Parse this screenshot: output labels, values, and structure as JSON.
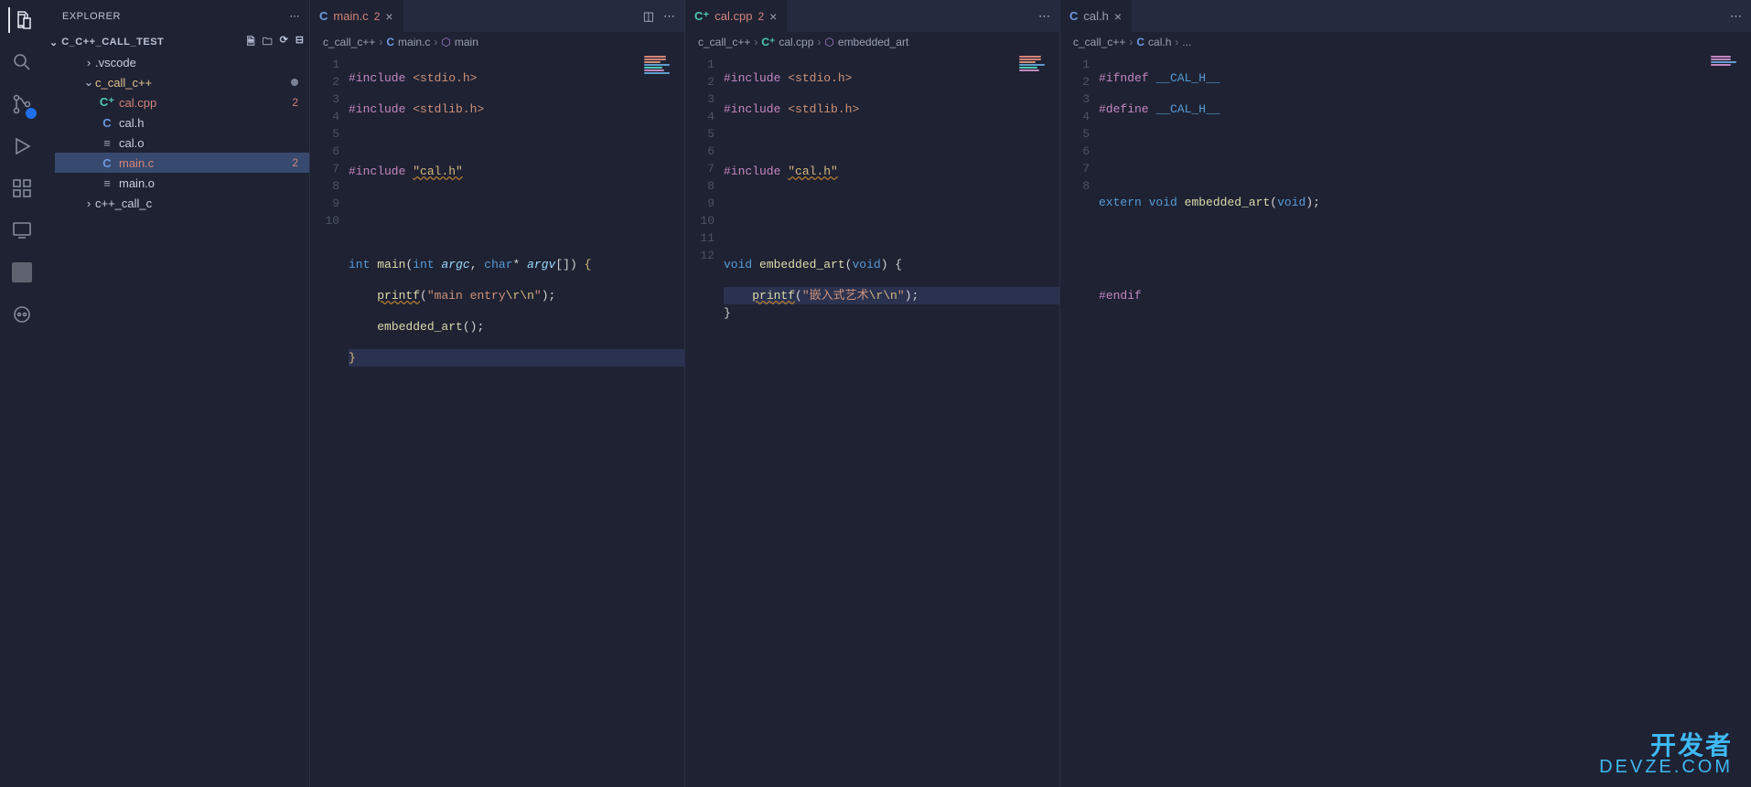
{
  "sidebar_title": "EXPLORER",
  "project_name": "C_C++_CALL_TEST",
  "tree": {
    "vscode": ".vscode",
    "c_call_cpp": "c_call_c++",
    "cpp_call_c": "c++_call_c",
    "files": {
      "cal_cpp": "cal.cpp",
      "cal_h": "cal.h",
      "cal_o": "cal.o",
      "main_c": "main.c",
      "main_o": "main.o"
    },
    "err_cal_cpp": "2",
    "err_main_c": "2"
  },
  "tabs": {
    "main_c": "main.c",
    "main_c_err": "2",
    "cal_cpp": "cal.cpp",
    "cal_cpp_err": "2",
    "cal_h": "cal.h"
  },
  "breadcrumbs": {
    "root": "c_call_c++",
    "main_c": "main.c",
    "main_sym": "main",
    "cal_cpp": "cal.cpp",
    "cal_sym": "embedded_art",
    "cal_h": "cal.h",
    "ell": "..."
  },
  "code": {
    "main": {
      "l1a": "#include",
      "l1b": "<stdio.h>",
      "l2a": "#include",
      "l2b": "<stdlib.h>",
      "l4a": "#include",
      "l4b": "\"cal.h\"",
      "l7a": "int",
      "l7b": "main",
      "l7c": "int",
      "l7d": "argc",
      "l7e": "char",
      "l7f": "argv",
      "l8a": "printf",
      "l8b": "\"main entry",
      "l8c": "\\r\\n",
      "l8d": "\"",
      "l9a": "embedded_art"
    },
    "calcpp": {
      "l1a": "#include",
      "l1b": "<stdio.h>",
      "l2a": "#include",
      "l2b": "<stdlib.h>",
      "l4a": "#include",
      "l4b": "\"cal.h\"",
      "l7a": "void",
      "l7b": "embedded_art",
      "l7c": "void",
      "l8a": "printf",
      "l8b": "\"嵌入式艺术",
      "l8c": "\\r\\n",
      "l8d": "\""
    },
    "calh": {
      "l1a": "#ifndef",
      "l1b": "__CAL_H__",
      "l2a": "#define",
      "l2b": "__CAL_H__",
      "l5a": "extern",
      "l5b": "void",
      "l5c": "embedded_art",
      "l5d": "void",
      "l8a": "#endif"
    }
  },
  "watermark": {
    "line1": "开发者",
    "line2": "DEVZE.COM"
  }
}
